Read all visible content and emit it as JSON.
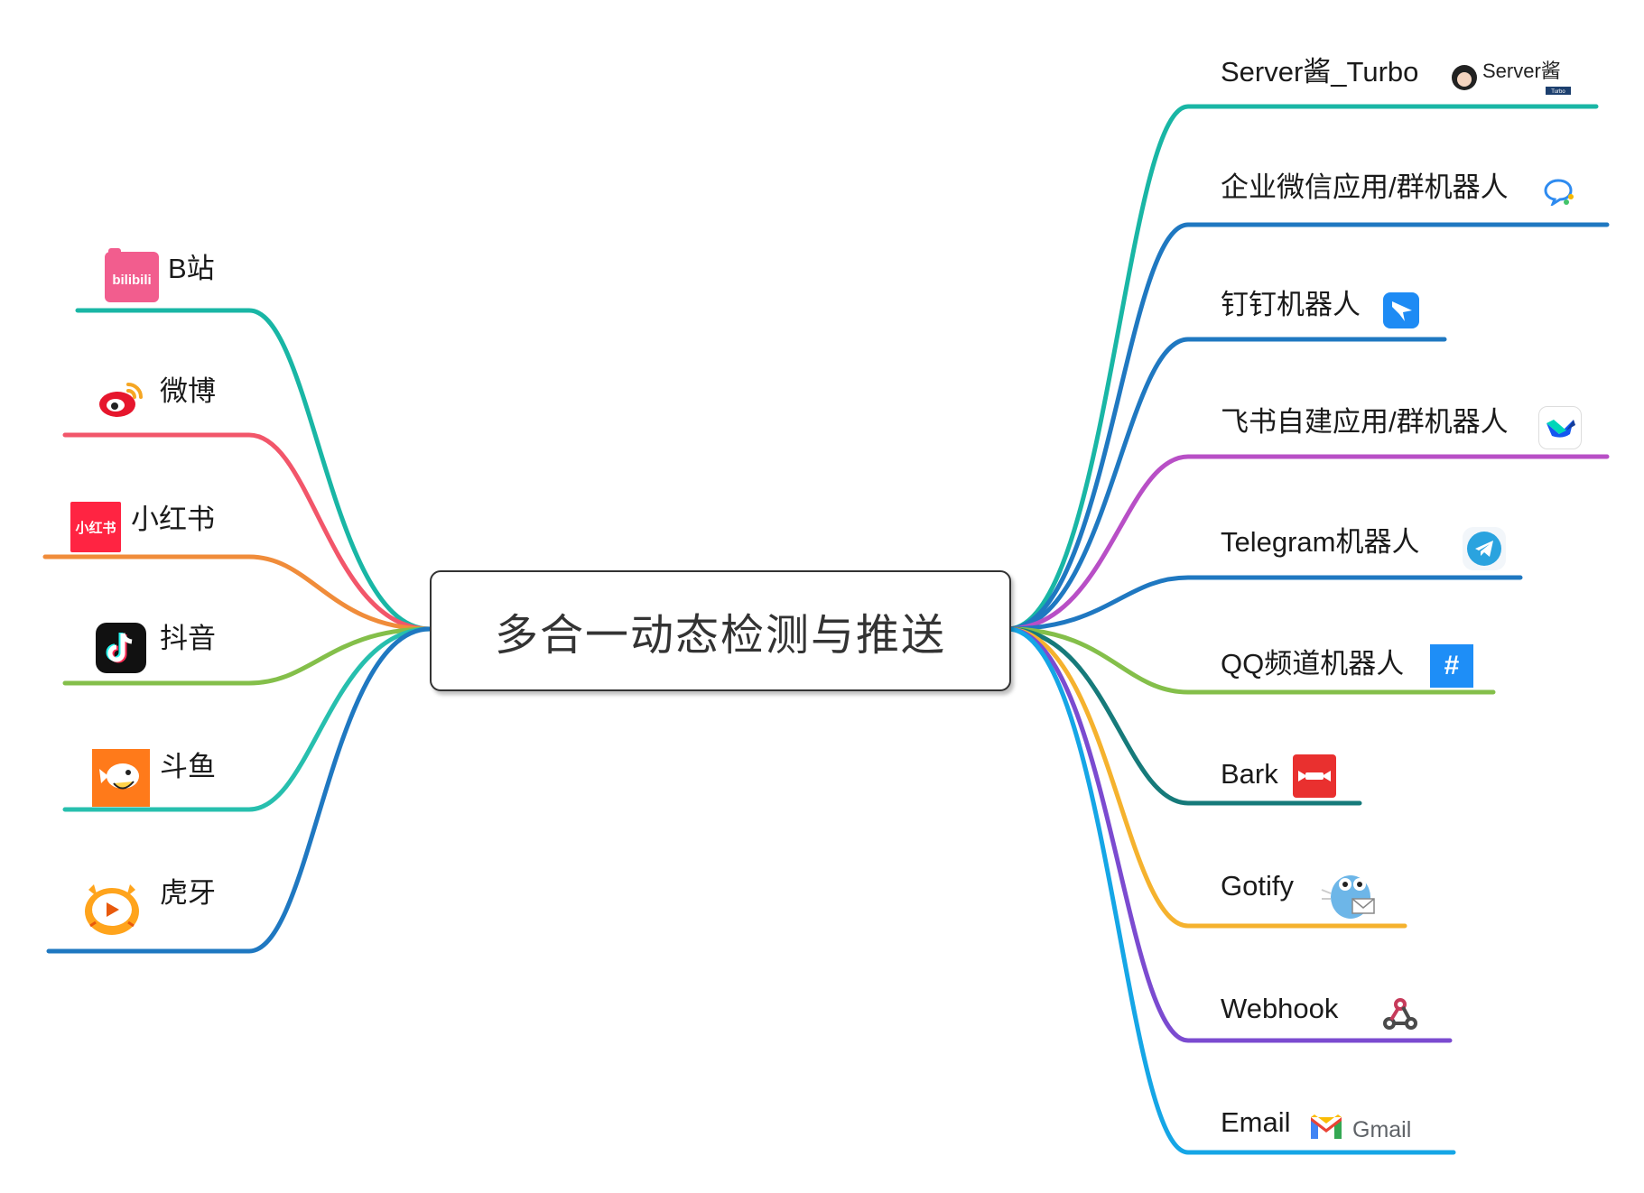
{
  "center": {
    "title": "多合一动态检测与推送"
  },
  "sources": [
    {
      "label": "B站",
      "icon": "bilibili-icon",
      "color": "#19b6a5"
    },
    {
      "label": "微博",
      "icon": "weibo-icon",
      "color": "#f2566a"
    },
    {
      "label": "小红书",
      "icon": "xiaohongshu-icon",
      "color": "#f08c3a"
    },
    {
      "label": "抖音",
      "icon": "douyin-icon",
      "color": "#84bf4a"
    },
    {
      "label": "斗鱼",
      "icon": "douyu-icon",
      "color": "#27bfae"
    },
    {
      "label": "虎牙",
      "icon": "huya-icon",
      "color": "#1f78c1"
    }
  ],
  "targets": [
    {
      "label": "Server酱_Turbo",
      "icon": "serverchan-icon",
      "color": "#19b6a5"
    },
    {
      "label": "企业微信应用/群机器人",
      "icon": "wecom-icon",
      "color": "#1f78c1"
    },
    {
      "label": "钉钉机器人",
      "icon": "dingtalk-icon",
      "color": "#1f78c1"
    },
    {
      "label": "飞书自建应用/群机器人",
      "icon": "feishu-icon",
      "color": "#b84fc6"
    },
    {
      "label": "Telegram机器人",
      "icon": "telegram-icon",
      "color": "#1f78c1"
    },
    {
      "label": "QQ频道机器人",
      "icon": "qq-channel-icon",
      "color": "#84bf4a"
    },
    {
      "label": "Bark",
      "icon": "bark-icon",
      "color": "#167a7a"
    },
    {
      "label": "Gotify",
      "icon": "gotify-icon",
      "color": "#f5b22e"
    },
    {
      "label": "Webhook",
      "icon": "webhook-icon",
      "color": "#7b4bd0"
    },
    {
      "label": "Email",
      "icon": "gmail-icon",
      "color": "#15a6e6"
    }
  ],
  "icon_text": {
    "bilibili": "bilibili",
    "xiaohongshu": "小红书",
    "qq_channel": "#",
    "serverchan": "Server酱",
    "serverchan_badge": "Turbo",
    "gmail": "Gmail"
  }
}
